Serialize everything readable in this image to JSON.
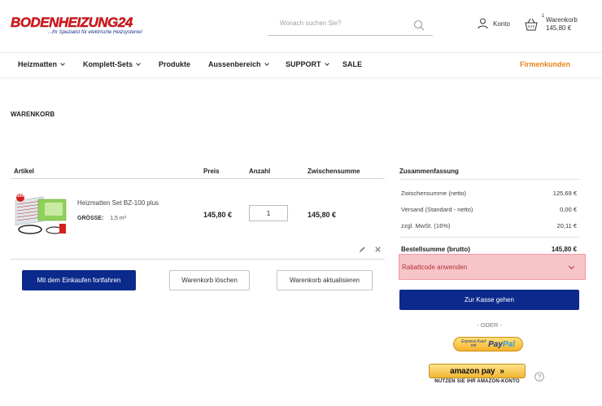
{
  "header": {
    "logo_text": "BODENHEIZUNG24",
    "logo_tagline": "...Ihr Spezialist für elektrische Heizsysteme!",
    "search_placeholder": "Wonach suchen Sie?",
    "account_label": "Konto",
    "cart_count": "1",
    "cart_label": "Warenkorb",
    "cart_total": "145,80 €"
  },
  "nav": {
    "items": [
      {
        "label": "Heizmatten",
        "dropdown": true
      },
      {
        "label": "Komplett-Sets",
        "dropdown": true
      },
      {
        "label": "Produkte",
        "dropdown": false
      },
      {
        "label": "Aussenbereich",
        "dropdown": true
      },
      {
        "label": "SUPPORT",
        "dropdown": true
      },
      {
        "label": "SALE",
        "dropdown": false
      }
    ],
    "business_link": "Firmenkunden"
  },
  "page_title": "WARENKORB",
  "cart_table": {
    "headers": [
      "Artikel",
      "Preis",
      "Anzahl",
      "Zwischensumme"
    ],
    "items": [
      {
        "name": "Heizmatten Set BZ-100 plus",
        "size_label": "GRÖSSE:",
        "size_value": "1,5 m²",
        "image_badge": "100",
        "price": "145,80 €",
        "quantity": "1",
        "subtotal": "145,80 €"
      }
    ]
  },
  "actions": {
    "continue_shopping": "Mit dem Einkaufen fortfahren",
    "clear_cart": "Warenkorb löschen",
    "update_cart": "Warenkorb aktualisieren"
  },
  "summary": {
    "title": "Zusammenfassung",
    "rows": [
      {
        "label": "Zwischensumme (netto)",
        "value": "125,69 €"
      },
      {
        "label": "Versand (Standard - netto)",
        "value": "0,00 €"
      },
      {
        "label": "zzgl. MwSt. (16%)",
        "value": "20,11 €"
      }
    ],
    "total_label": "Bestellsumme (brutto)",
    "total_value": "145,80 €",
    "coupon_label": "Rabattcode anwenden",
    "checkout_button": "Zur Kasse gehen",
    "or_divider": "- ODER -",
    "paypal_express": "Express-Kauf",
    "paypal_mit": "mit",
    "paypal_logo_a": "Pay",
    "paypal_logo_b": "Pal",
    "amazon_logo": "amazon pay",
    "amazon_sub": "NUTZEN SIE IHR AMAZON-KONTO"
  },
  "colors": {
    "primary": "#0c2a8c",
    "accent_orange": "#e8821e",
    "logo_red": "#e1151b",
    "coupon_highlight": "#f7c4c8"
  }
}
